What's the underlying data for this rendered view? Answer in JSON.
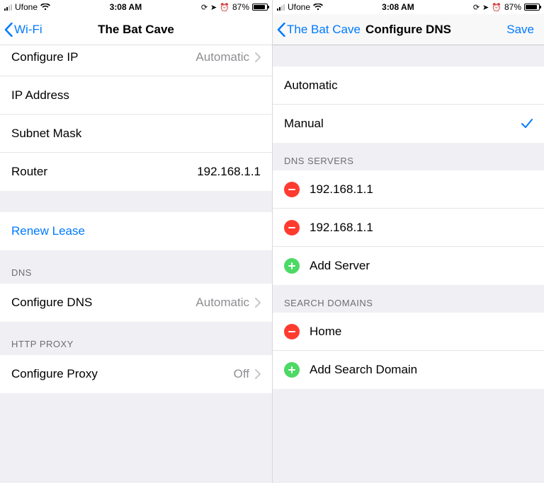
{
  "status": {
    "carrier": "Ufone",
    "time": "3:08 AM",
    "battery_pct": "87%"
  },
  "left": {
    "back_label": "Wi-Fi",
    "title": "The Bat Cave",
    "rows": {
      "configure_ip": {
        "label": "Configure IP",
        "value": "Automatic"
      },
      "ip_address": {
        "label": "IP Address",
        "value": ""
      },
      "subnet_mask": {
        "label": "Subnet Mask",
        "value": ""
      },
      "router": {
        "label": "Router",
        "value": "192.168.1.1"
      },
      "renew_lease": {
        "label": "Renew Lease"
      },
      "configure_dns": {
        "label": "Configure DNS",
        "value": "Automatic"
      },
      "configure_proxy": {
        "label": "Configure Proxy",
        "value": "Off"
      }
    },
    "section_dns": "DNS",
    "section_http_proxy": "HTTP PROXY"
  },
  "right": {
    "back_label": "The Bat Cave",
    "title": "Configure DNS",
    "save_label": "Save",
    "option_automatic": "Automatic",
    "option_manual": "Manual",
    "section_dns_servers": "DNS SERVERS",
    "dns_servers": [
      "192.168.1.1",
      "192.168.1.1"
    ],
    "add_server": "Add Server",
    "section_search_domains": "SEARCH DOMAINS",
    "search_domains": [
      "Home"
    ],
    "add_search_domain": "Add Search Domain"
  }
}
